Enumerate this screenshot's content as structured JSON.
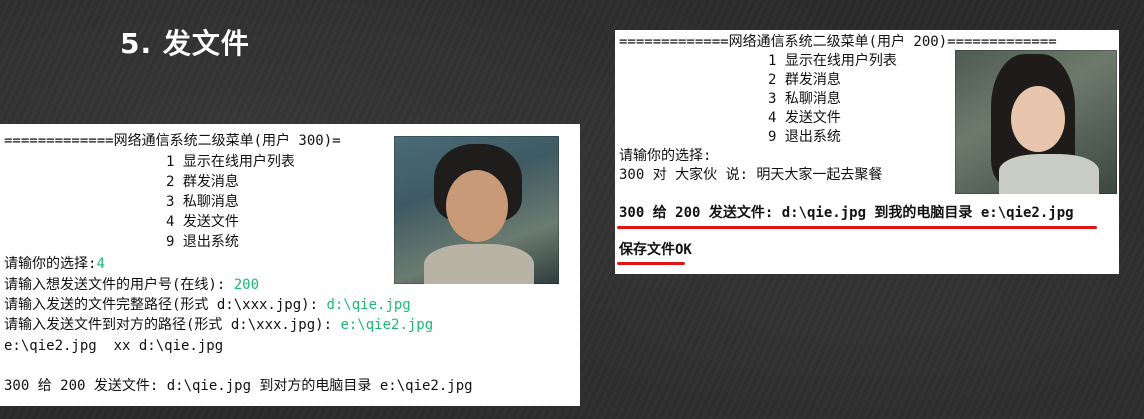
{
  "slide": {
    "title": "5. 发文件"
  },
  "left_console": {
    "header": "=============网络通信系统二级菜单(用户 300)=",
    "menu": [
      "1 显示在线用户列表",
      "2 群发消息",
      "3 私聊消息",
      "4 发送文件",
      "9 退出系统"
    ],
    "prompt_label": "请输你的选择:",
    "prompt_value": "4",
    "target_label": "请输入想发送文件的用户号(在线): ",
    "target_value": "200",
    "src_label": "请输入发送的文件完整路径(形式 d:\\xxx.jpg): ",
    "src_value": "d:\\qie.jpg",
    "dst_label": "请输入发送文件到对方的路径(形式 d:\\xxx.jpg): ",
    "dst_value": "e:\\qie2.jpg",
    "echo": "e:\\qie2.jpg  xx d:\\qie.jpg",
    "result": "300 给 200 发送文件: d:\\qie.jpg 到对方的电脑目录 e:\\qie2.jpg"
  },
  "right_console": {
    "header": "=============网络通信系统二级菜单(用户 200)=============",
    "menu": [
      "1 显示在线用户列表",
      "2 群发消息",
      "3 私聊消息",
      "4 发送文件",
      "9 退出系统"
    ],
    "prompt_label": "请输你的选择:",
    "group_msg": "300 对 大家伙 说: 明天大家一起去聚餐",
    "received": "300 给 200 发送文件: d:\\qie.jpg 到我的电脑目录 e:\\qie2.jpg",
    "saved": "保存文件OK"
  },
  "colors": {
    "highlight_green": "#1db974",
    "underline_red": "#e01515"
  }
}
